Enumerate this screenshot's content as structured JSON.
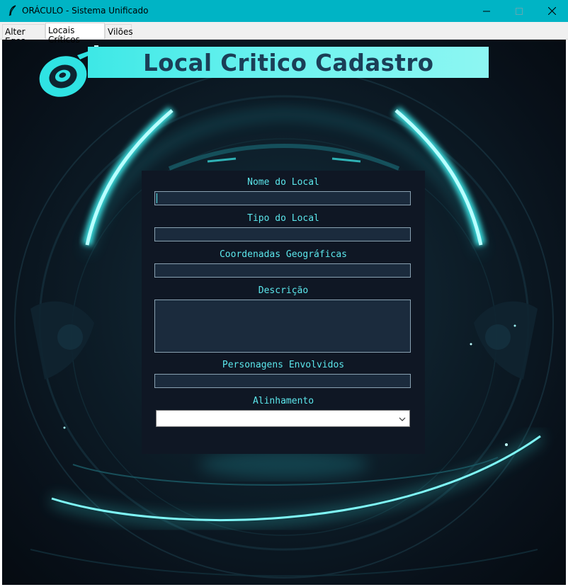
{
  "window": {
    "title": "ORÁCULO - Sistema Unificado",
    "accent": "#00b4c5"
  },
  "tabs": [
    {
      "label": "Alter Egos",
      "active": false
    },
    {
      "label": "Locais Críticos",
      "active": true
    },
    {
      "label": "Vilões",
      "active": false
    }
  ],
  "banner": {
    "title": "Local Critico Cadastro"
  },
  "form": {
    "fields": [
      {
        "label": "Nome do Local",
        "value": ""
      },
      {
        "label": "Tipo do Local",
        "value": ""
      },
      {
        "label": "Coordenadas Geográficas",
        "value": ""
      },
      {
        "label": "Descrição",
        "value": ""
      },
      {
        "label": "Personagens Envolvidos",
        "value": ""
      },
      {
        "label": "Alinhamento",
        "value": ""
      }
    ],
    "label_color": "#5ce7ec",
    "panel_color": "#0f1724"
  },
  "icons": {
    "app": "feather-icon",
    "minimize": "minimize-icon",
    "maximize": "maximize-icon",
    "close": "close-icon",
    "combo_arrow": "chevron-down-icon"
  }
}
